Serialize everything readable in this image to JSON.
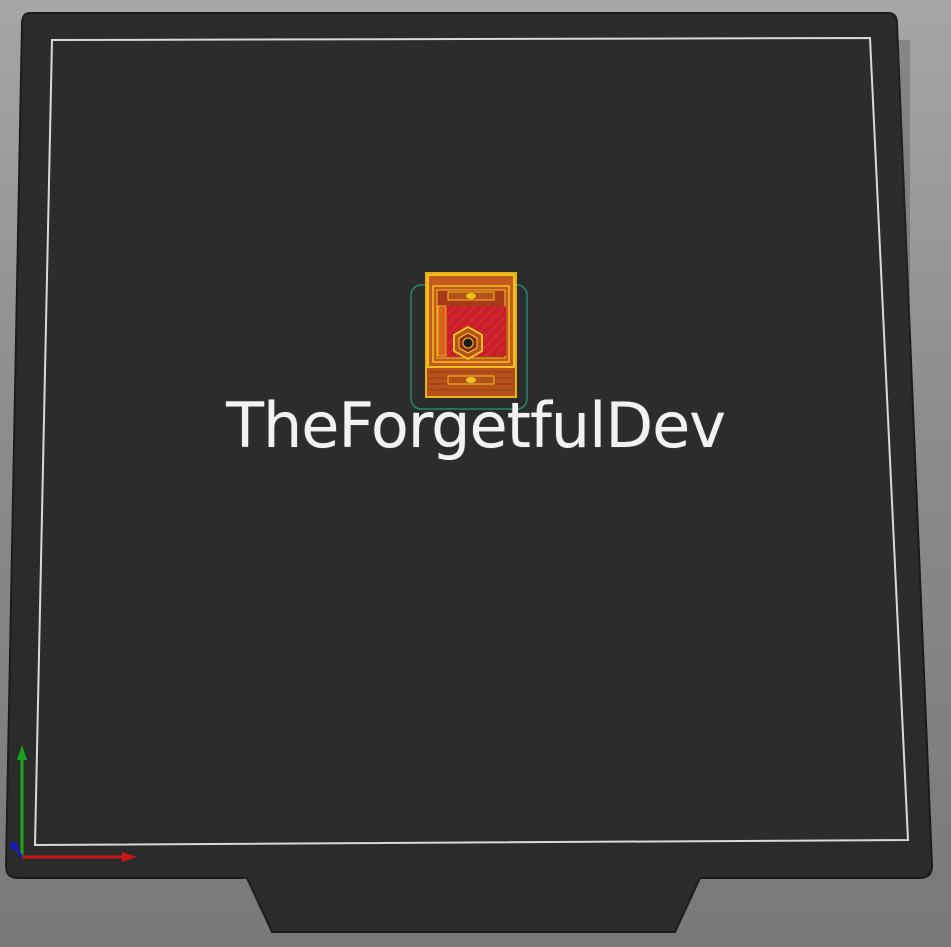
{
  "view": {
    "bed_label": "TheForgetfulDev"
  },
  "colors": {
    "background": "#9a9a9a",
    "bed_plate": "#2a2a2a",
    "bed_outline": "#d9d9d9",
    "part_fill": "#c0541c",
    "part_perimeter": "#e6b117",
    "part_infill": "#c81f2a",
    "skirt": "#1f8a6e",
    "axis_x": "#c81717",
    "axis_y": "#19a319",
    "axis_z": "#1a1ab8"
  },
  "icons": {
    "axes": "xyz-axes-icon",
    "object": "sliced-object-icon"
  }
}
